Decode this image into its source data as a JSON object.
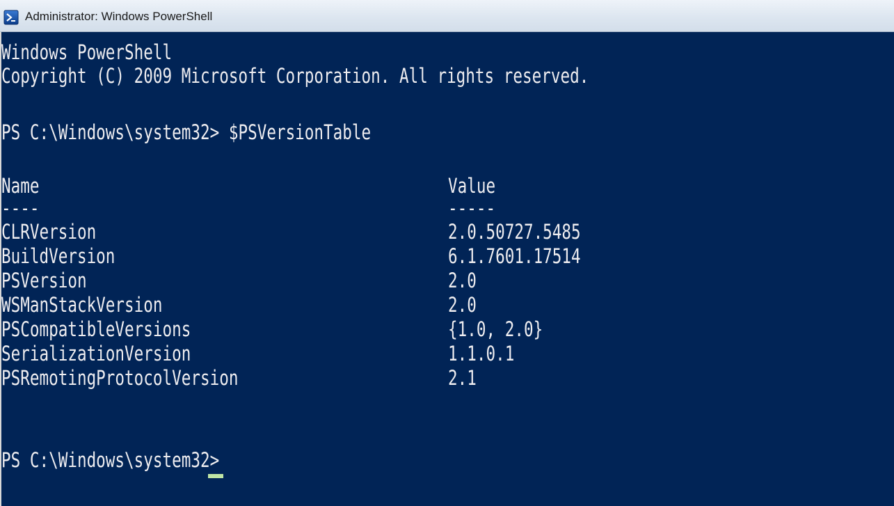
{
  "window": {
    "title": "Administrator: Windows PowerShell",
    "icon": "powershell-icon",
    "console_background": "#012456",
    "console_text_color": "#EEEDF0"
  },
  "console": {
    "banner_line1": "Windows PowerShell",
    "banner_line2": "Copyright (C) 2009 Microsoft Corporation. All rights reserved.",
    "prompt": "PS C:\\Windows\\system32>",
    "command": "$PSVersionTable",
    "table": {
      "headers": [
        "Name",
        "Value"
      ],
      "separators": [
        "----",
        "-----"
      ],
      "rows": [
        {
          "name": "CLRVersion",
          "value": "2.0.50727.5485"
        },
        {
          "name": "BuildVersion",
          "value": "6.1.7601.17514"
        },
        {
          "name": "PSVersion",
          "value": "2.0"
        },
        {
          "name": "WSManStackVersion",
          "value": "2.0"
        },
        {
          "name": "PSCompatibleVersions",
          "value": "{1.0, 2.0}"
        },
        {
          "name": "SerializationVersion",
          "value": "1.1.0.1"
        },
        {
          "name": "PSRemotingProtocolVersion",
          "value": "2.1"
        }
      ]
    },
    "final_prompt": "PS C:\\Windows\\system32>"
  }
}
